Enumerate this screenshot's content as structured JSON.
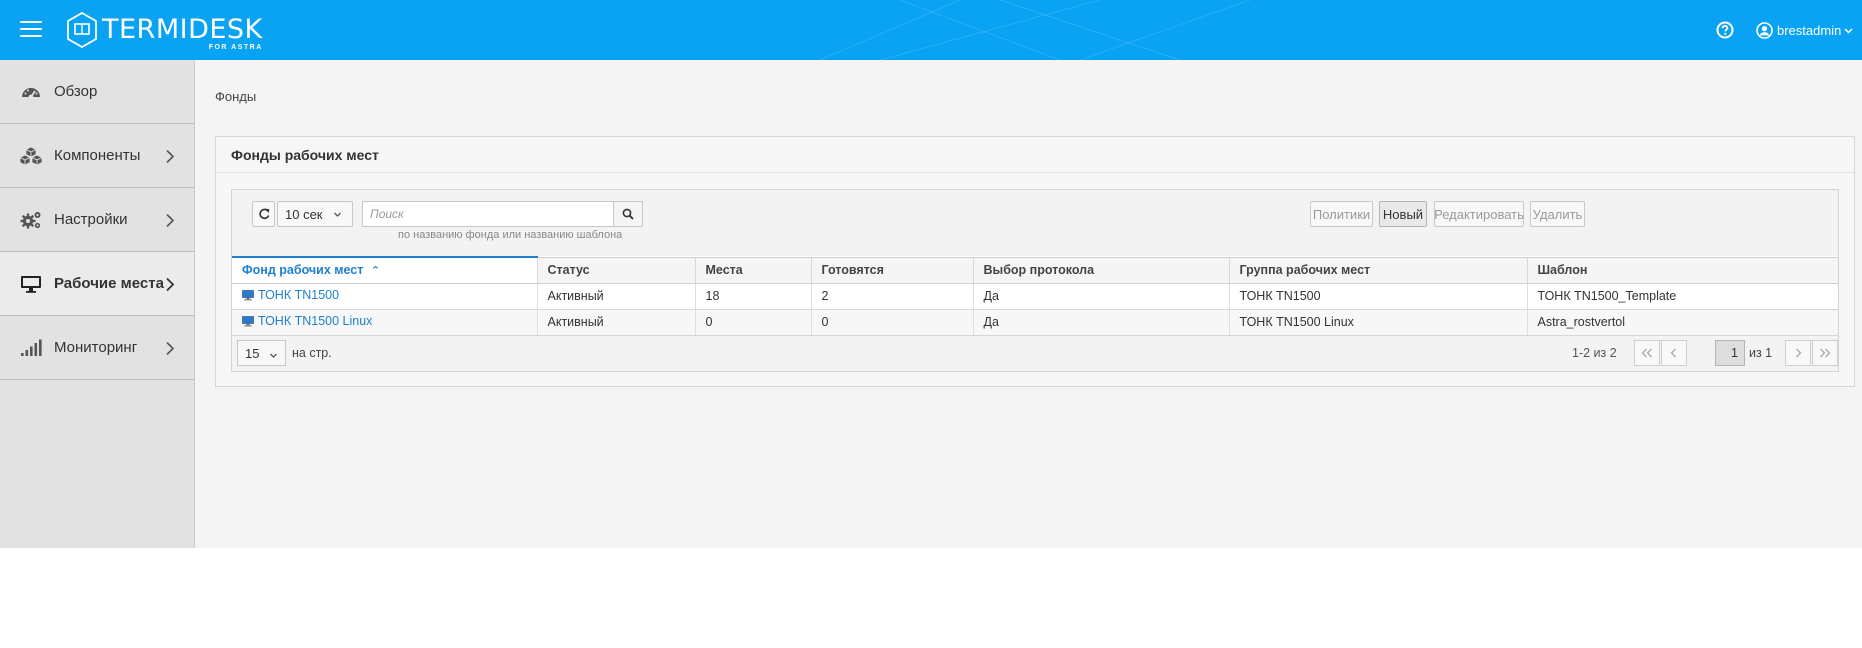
{
  "header": {
    "logo_title": "TERMIDESK",
    "logo_subtitle": "FOR ASTRA",
    "username": "brestadmin",
    "brand_color": "#0aa3f3"
  },
  "sidebar": {
    "items": [
      {
        "label": "Обзор",
        "icon": "dashboard-icon"
      },
      {
        "label": "Компоненты",
        "icon": "cubes-icon"
      },
      {
        "label": "Настройки",
        "icon": "gears-icon"
      },
      {
        "label": "Рабочие места",
        "icon": "monitor-icon"
      },
      {
        "label": "Мониторинг",
        "icon": "signal-bars-icon"
      }
    ]
  },
  "breadcrumb": "Фонды",
  "panel": {
    "title": "Фонды рабочих мест"
  },
  "toolbar": {
    "refresh_interval": "10 сек",
    "search_placeholder": "Поиск",
    "search_hint": "по названию фонда или названию шаблона",
    "btn_policies": "Политики",
    "btn_new": "Новый",
    "btn_edit": "Редактировать",
    "btn_delete": "Удалить"
  },
  "table": {
    "columns": [
      "Фонд рабочих мест",
      "Статус",
      "Места",
      "Готовятся",
      "Выбор протокола",
      "Группа рабочих мест",
      "Шаблон"
    ],
    "sort_indicator": "⌃",
    "rows": [
      {
        "name": "ТОНК TN1500",
        "status": "Активный",
        "seats": "18",
        "preparing": "2",
        "protocol": "Да",
        "group": "ТОНК TN1500",
        "template": "ТОНК TN1500_Template"
      },
      {
        "name": "ТОНК TN1500 Linux",
        "status": "Активный",
        "seats": "0",
        "preparing": "0",
        "protocol": "Да",
        "group": "ТОНК TN1500 Linux",
        "template": "Astra_rostvertol"
      }
    ]
  },
  "pagination": {
    "per_page": "15",
    "per_page_label": "на стр.",
    "range": "1-2 из 2",
    "current_page": "1",
    "of_pages": "из 1"
  }
}
